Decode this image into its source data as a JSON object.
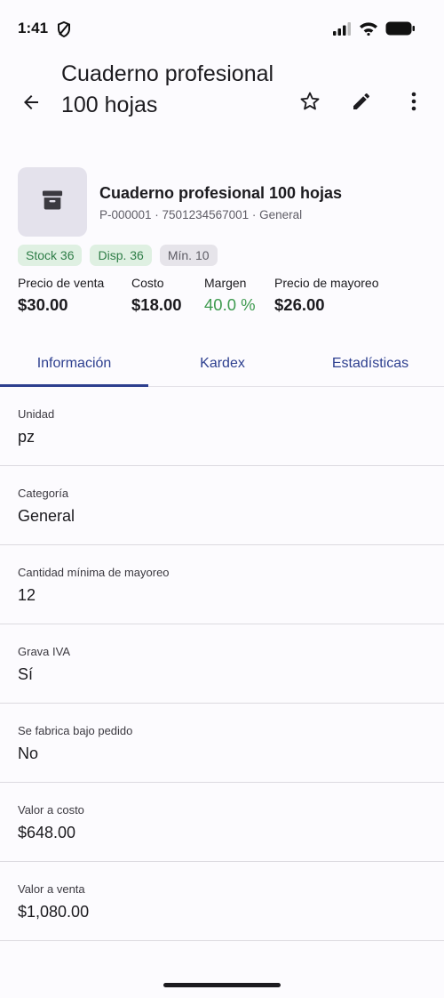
{
  "status_bar": {
    "time": "1:41"
  },
  "app_bar": {
    "title": "Cuaderno profesional 100 hojas"
  },
  "product": {
    "name": "Cuaderno profesional 100 hojas",
    "meta": "P-000001 · 7501234567001 · General",
    "chips": {
      "stock": "Stock 36",
      "available": "Disp. 36",
      "minimum": "Mín. 10"
    }
  },
  "prices": {
    "sale_label": "Precio de venta",
    "sale_value": "$30.00",
    "cost_label": "Costo",
    "cost_value": "$18.00",
    "margin_label": "Margen",
    "margin_value": "40.0 %",
    "wholesale_label": "Precio de mayoreo",
    "wholesale_value": "$26.00"
  },
  "tabs": [
    {
      "label": "Información"
    },
    {
      "label": "Kardex"
    },
    {
      "label": "Estadísticas"
    }
  ],
  "info": [
    {
      "label": "Unidad",
      "value": "pz"
    },
    {
      "label": "Categoría",
      "value": "General"
    },
    {
      "label": "Cantidad mínima de mayoreo",
      "value": "12"
    },
    {
      "label": "Grava IVA",
      "value": "Sí"
    },
    {
      "label": "Se fabrica bajo pedido",
      "value": "No"
    },
    {
      "label": "Valor a costo",
      "value": "$648.00"
    },
    {
      "label": "Valor a venta",
      "value": "$1,080.00"
    }
  ],
  "colors": {
    "accent": "#2d3f8f",
    "positive": "#3e9a4f",
    "chip_green_bg": "#dff0e2",
    "chip_grey_bg": "#e6e4ea"
  },
  "icons": [
    "shield-icon",
    "signal-icon",
    "wifi-icon",
    "battery-icon",
    "back-arrow-icon",
    "star-icon",
    "pencil-icon",
    "more-vert-icon",
    "archive-box-icon"
  ]
}
